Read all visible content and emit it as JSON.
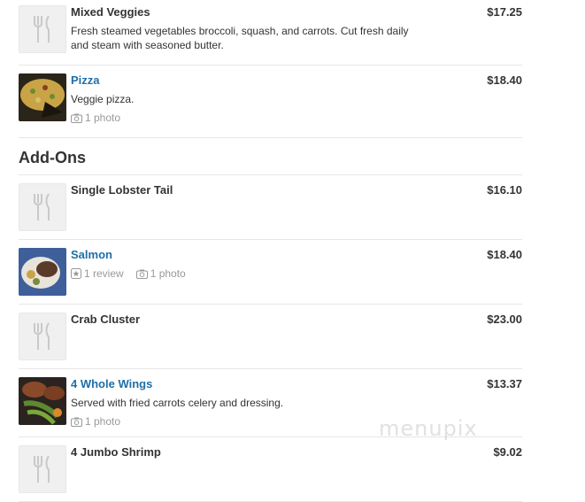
{
  "section": {
    "title": "Add-Ons"
  },
  "items": [
    {
      "name": "Mixed Veggies",
      "price": "$17.25",
      "description": "Fresh steamed vegetables broccoli, squash, and carrots. Cut fresh daily and steam with seasoned butter."
    },
    {
      "name": "Pizza",
      "price": "$18.40",
      "description": "Veggie pizza.",
      "photos": "1 photo"
    },
    {
      "name": "Single Lobster Tail",
      "price": "$16.10"
    },
    {
      "name": "Salmon",
      "price": "$18.40",
      "reviews": "1 review",
      "photos": "1 photo"
    },
    {
      "name": "Crab Cluster",
      "price": "$23.00"
    },
    {
      "name": "4 Whole Wings",
      "price": "$13.37",
      "description": "Served with fried carrots celery and dressing.",
      "photos": "1 photo"
    },
    {
      "name": "4 Jumbo Shrimp",
      "price": "$9.02"
    }
  ],
  "watermark": "menupix",
  "colors": {
    "link": "#1f6fa8",
    "text": "#333333",
    "muted": "#999999",
    "divider": "#e6e6e6"
  },
  "icons": {
    "placeholder": "fork-knife-icon",
    "photo": "camera-icon",
    "review": "star-icon"
  }
}
